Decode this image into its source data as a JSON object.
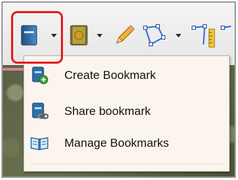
{
  "toolbar": {
    "icons": [
      "bookmark-icon",
      "bookmark-alt-icon",
      "pencil-icon",
      "polygon-icon",
      "ruler-icon"
    ]
  },
  "menu": {
    "items": [
      {
        "label": "Create Bookmark",
        "icon": "create-bookmark-icon"
      },
      {
        "label": "Share bookmark",
        "icon": "share-bookmark-icon"
      },
      {
        "label": "Manage Bookmarks",
        "icon": "manage-bookmarks-icon"
      }
    ]
  },
  "colors": {
    "highlight": "#e41d1d",
    "menu_bg": "#fbf5ee",
    "book_blue": "#2f6fa8",
    "book_olive": "#8a7d2a"
  }
}
